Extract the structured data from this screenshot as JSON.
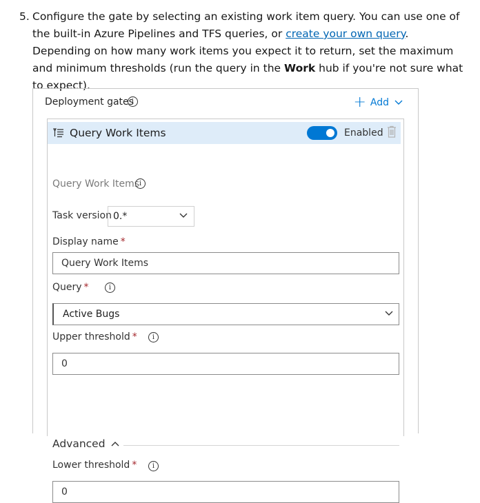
{
  "step": {
    "number": "5.",
    "text_before_link": "Configure the gate by selecting an existing work item query. You can use one of the built-in Azure Pipelines and TFS queries, or ",
    "link_text": "create your own query",
    "text_after_link": ". Depending on how many work items you expect it to return, set the maximum and minimum thresholds (run the query in the ",
    "bold_text": "Work",
    "text_end": " hub if you're not sure what to expect)."
  },
  "panel": {
    "title": "Deployment gates",
    "info_icon": "info-icon",
    "add_label": "Add",
    "add_icon": "plus-icon",
    "accent_color": "#0078d4"
  },
  "task": {
    "icon": "query-list-icon",
    "name": "Query Work Items",
    "enabled_label": "Enabled",
    "enabled": true,
    "delete_icon": "trash-icon",
    "header_bg": "#deecf9",
    "subtitle": "Query Work Items"
  },
  "form": {
    "task_version_label": "Task version",
    "task_version_value": "0.*",
    "display_name_label": "Display name",
    "display_name_value": "Query Work Items",
    "query_label": "Query",
    "query_value": "Active Bugs",
    "upper_threshold_label": "Upper threshold",
    "upper_threshold_value": "0",
    "advanced_label": "Advanced",
    "lower_threshold_label": "Lower threshold",
    "lower_threshold_value": "0",
    "required_mark": "*"
  }
}
